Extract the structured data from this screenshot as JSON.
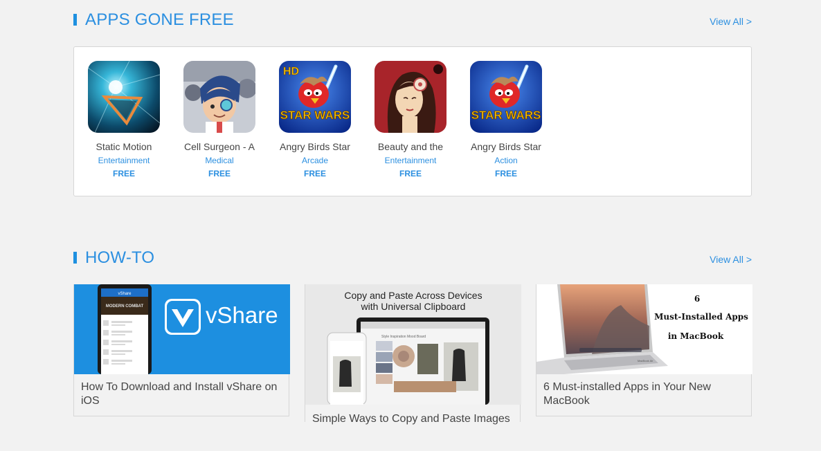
{
  "apps_section": {
    "title": "APPS GONE FREE",
    "view_all": "View All >",
    "apps": [
      {
        "name": "Static Motion",
        "category": "Entertainment",
        "price": "FREE",
        "icon": "static-motion-icon"
      },
      {
        "name": "Cell Surgeon - A",
        "category": "Medical",
        "price": "FREE",
        "icon": "cell-surgeon-icon"
      },
      {
        "name": "Angry Birds Star",
        "category": "Arcade",
        "price": "FREE",
        "icon": "angry-birds-star-wars-hd-icon",
        "icon_badge": "HD",
        "icon_text": "STAR WARS"
      },
      {
        "name": "Beauty and the",
        "category": "Entertainment",
        "price": "FREE",
        "icon": "beauty-and-the-icon"
      },
      {
        "name": "Angry Birds Star",
        "category": "Action",
        "price": "FREE",
        "icon": "angry-birds-star-wars-icon",
        "icon_text": "STAR WARS"
      }
    ]
  },
  "howto_section": {
    "title": "HOW-TO",
    "view_all": "View All >",
    "articles": [
      {
        "title": "How To Download and Install vShare on iOS",
        "thumb": {
          "brand": "vShare",
          "phone_header": "vShare",
          "banner": "MODERN COMBAT"
        }
      },
      {
        "title": "Simple Ways to Copy and Paste Images",
        "thumb": {
          "headline_1": "Copy and Paste Across Devices",
          "headline_2": "with Universal Clipboard",
          "board_label": "Style Inspiration Mood Board"
        }
      },
      {
        "title": "6 Must-installed Apps in Your New MacBook",
        "thumb": {
          "line_1": "6",
          "line_2": "Must-Installed Apps",
          "line_3": "in MacBook",
          "laptop_label": "MacBook Air"
        }
      }
    ]
  },
  "colors": {
    "accent": "#2b8fe0",
    "background": "#f2f2f2",
    "card_border": "#d6d6d6"
  }
}
